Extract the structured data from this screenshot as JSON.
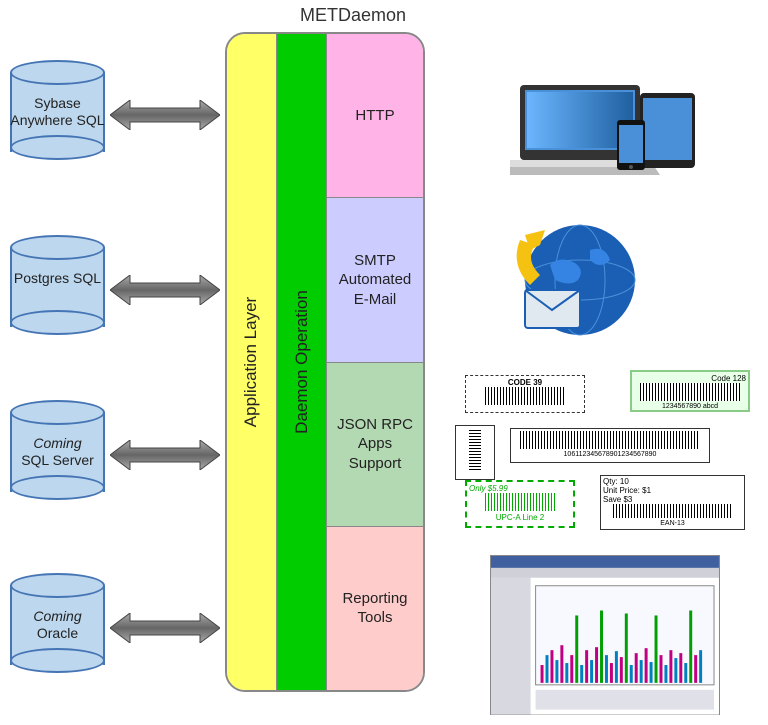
{
  "title": "METDaemon",
  "databases": [
    {
      "label": "Sybase Anywhere SQL",
      "coming": false
    },
    {
      "label": "Postgres SQL",
      "coming": false
    },
    {
      "label": "SQL Server",
      "coming": true
    },
    {
      "label": "Oracle",
      "coming": true
    }
  ],
  "layers": {
    "app": "Application Layer",
    "daemon": "Daemon Operation"
  },
  "modules": [
    {
      "label": "HTTP",
      "class": "m-http"
    },
    {
      "label": "SMTP Automated E-Mail",
      "class": "m-smtp"
    },
    {
      "label": "JSON RPC Apps Support",
      "class": "m-json"
    },
    {
      "label": "Reporting Tools",
      "class": "m-report"
    }
  ],
  "barcodes": {
    "code39": "CODE 39",
    "code128": "Code 128",
    "code128num": "1234567890 abcd",
    "upca": "UPC-A Line 2",
    "only": "Only $5.99",
    "ean13": "EAN-13",
    "qty": "Qty: 10",
    "unitprice": "Unit Price: $1",
    "save": "Save $3"
  }
}
